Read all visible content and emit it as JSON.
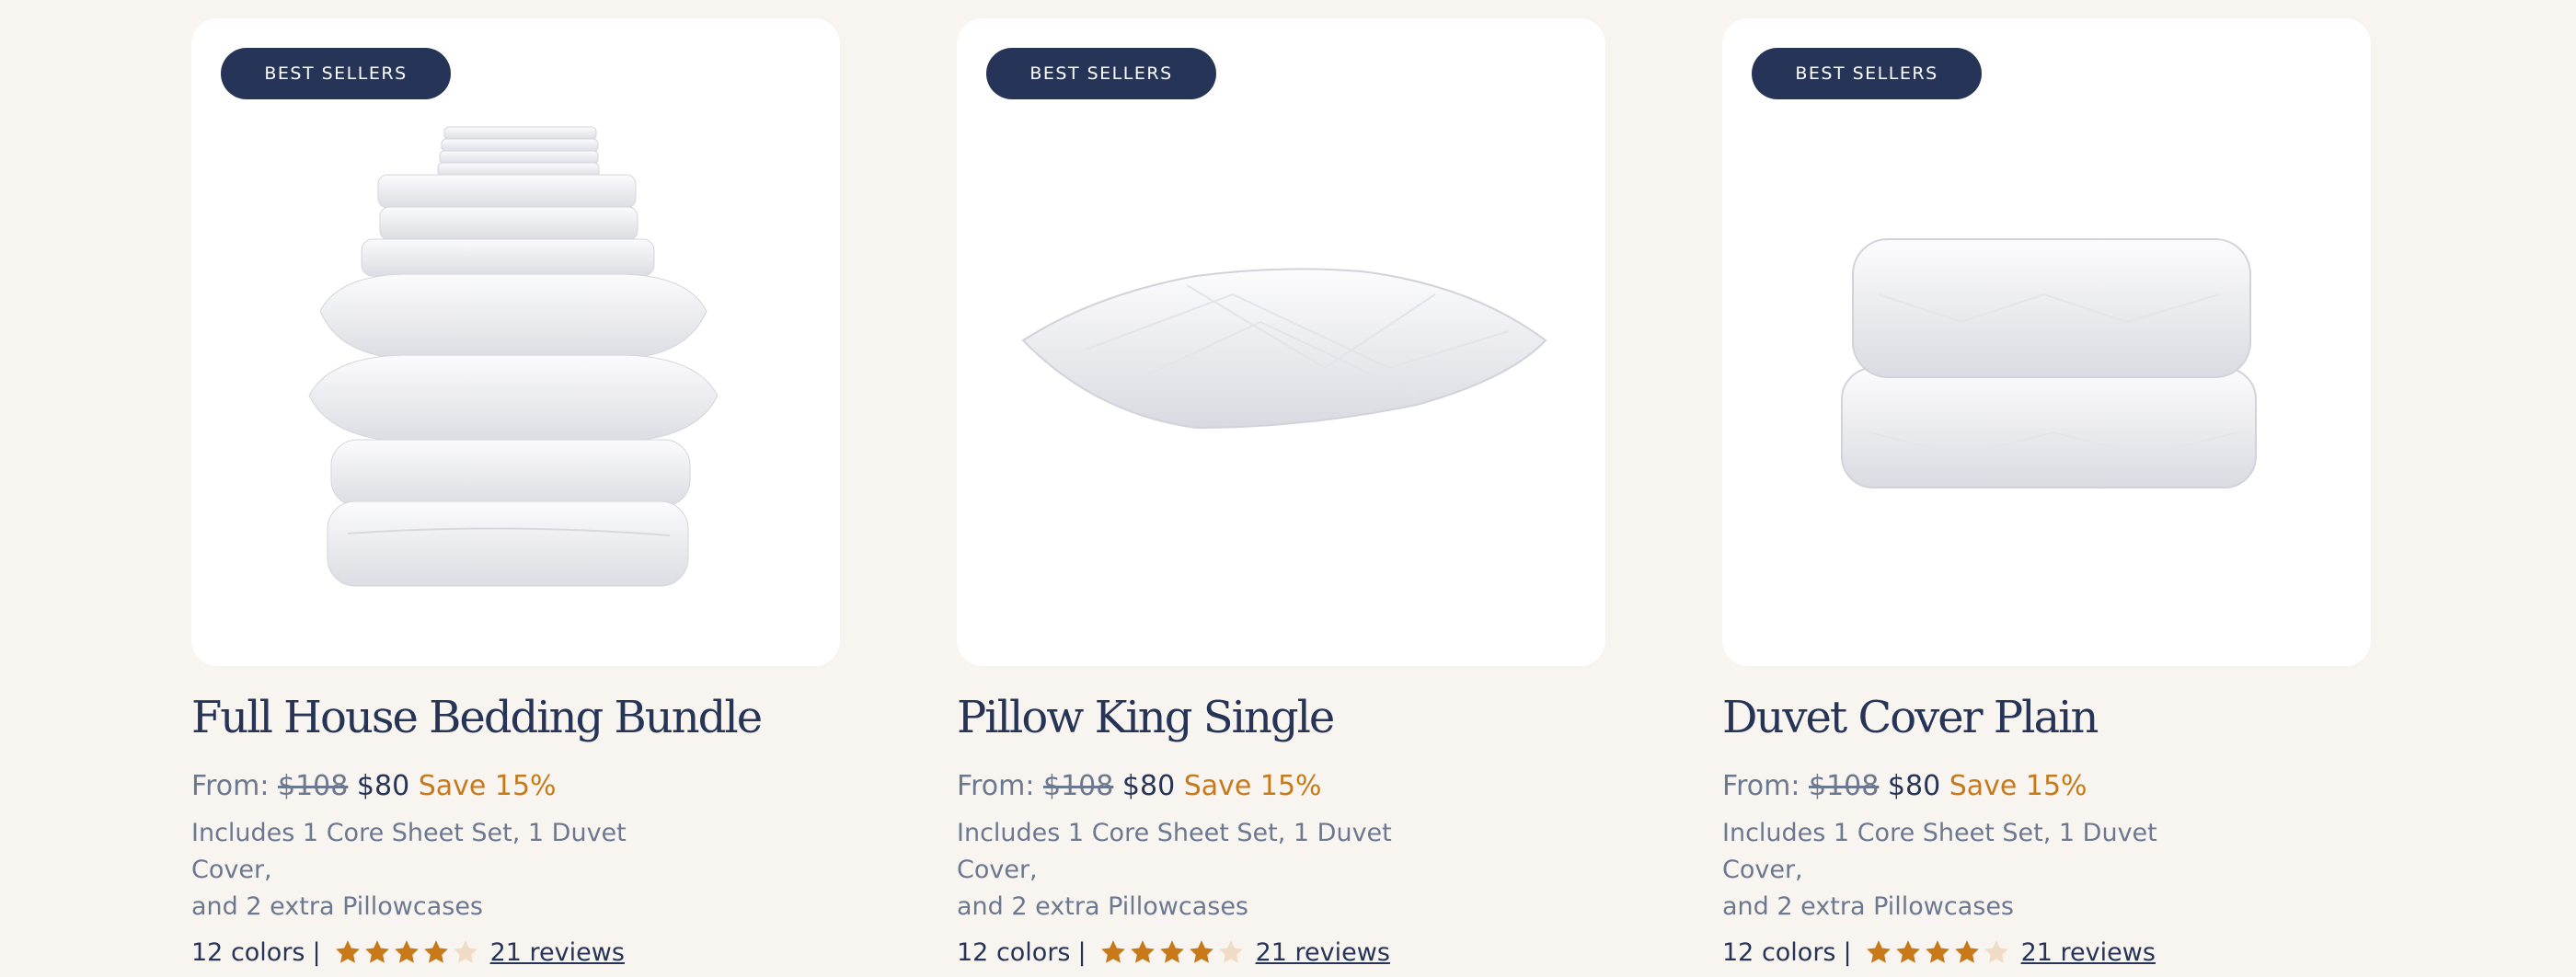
{
  "colors": {
    "background": "#f8f5f0",
    "badge": "#253457",
    "title": "#253457",
    "muted": "#6b7890",
    "accent": "#c77a1a",
    "star_filled": "#c77a1a",
    "star_empty": "#f0dcc4"
  },
  "products": [
    {
      "badge": "BEST SELLERS",
      "image_icon": "bedding-bundle-image",
      "title": "Full House Bedding Bundle",
      "price_prefix": "From:",
      "old_price": "$108",
      "new_price": "$80",
      "save": "Save 15%",
      "desc_line1": "Includes 1 Core Sheet Set, 1 Duvet Cover,",
      "desc_line2": "and 2 extra Pillowcases",
      "colors": "12 colors",
      "separator": "|",
      "rating": 4,
      "rating_max": 5,
      "reviews": "21 reviews"
    },
    {
      "badge": "BEST SELLERS",
      "image_icon": "pillow-image",
      "title": "Pillow King Single",
      "price_prefix": "From:",
      "old_price": "$108",
      "new_price": "$80",
      "save": "Save 15%",
      "desc_line1": "Includes 1 Core Sheet Set, 1 Duvet Cover,",
      "desc_line2": "and 2 extra Pillowcases",
      "colors": "12 colors",
      "separator": "|",
      "rating": 4,
      "rating_max": 5,
      "reviews": "21 reviews"
    },
    {
      "badge": "BEST SELLERS",
      "image_icon": "folded-duvet-image",
      "title": "Duvet Cover Plain",
      "price_prefix": "From:",
      "old_price": "$108",
      "new_price": "$80",
      "save": "Save 15%",
      "desc_line1": "Includes 1 Core Sheet Set, 1 Duvet Cover,",
      "desc_line2": "and 2 extra Pillowcases",
      "colors": "12 colors",
      "separator": "|",
      "rating": 4,
      "rating_max": 5,
      "reviews": "21 reviews"
    }
  ]
}
